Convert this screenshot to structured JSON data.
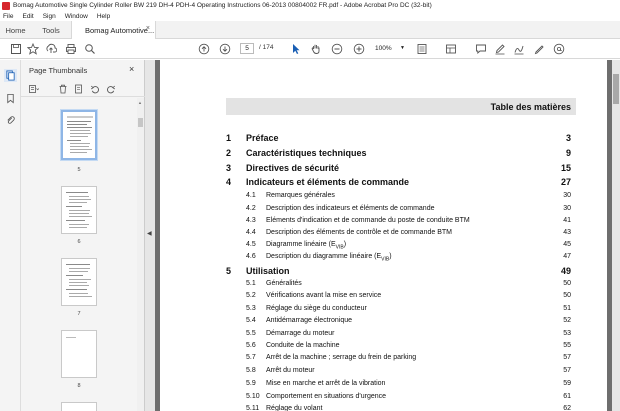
{
  "window": {
    "title": "Bomag Automotive Single Cylinder Roller BW 219 DH-4 PDH-4 Operating Instructions 06-2013 00804002 FR.pdf - Adobe Acrobat Pro DC (32-bit)"
  },
  "menu": [
    "File",
    "Edit",
    "Sign",
    "Window",
    "Help"
  ],
  "tabs": {
    "home": "Home",
    "tools": "Tools",
    "doc": "Bomag Automotive...",
    "close": "×"
  },
  "toolbar": {
    "current_page": "5",
    "page_count": "/ 174",
    "zoom": "100%"
  },
  "thumbnails": {
    "title": "Page Thumbnails",
    "close": "×",
    "pages": [
      "5",
      "6",
      "7",
      "8"
    ]
  },
  "document": {
    "header": "Table des matières",
    "toc": [
      {
        "level": 1,
        "num": "1",
        "text": "Préface",
        "page": "3"
      },
      {
        "level": 1,
        "num": "2",
        "text": "Caractéristiques techniques",
        "page": "9"
      },
      {
        "level": 1,
        "num": "3",
        "text": "Directives de sécurité",
        "page": "15"
      },
      {
        "level": 1,
        "num": "4",
        "text": "Indicateurs et éléments de commande",
        "page": "27"
      },
      {
        "level": 2,
        "num": "4.1",
        "text": "Remarques générales",
        "page": "30"
      },
      {
        "level": 2,
        "num": "4.2",
        "text": "Description des indicateurs et éléments de commande",
        "page": "30"
      },
      {
        "level": 2,
        "num": "4.3",
        "text": "Eléments d'indication et de commande du poste de conduite BTM",
        "page": "41"
      },
      {
        "level": 2,
        "num": "4.4",
        "text": "Description des éléments de contrôle et de commande BTM",
        "page": "43"
      },
      {
        "level": 2,
        "num": "4.5",
        "text": "Diagramme linéaire  (E",
        "sub": "VIB",
        "tail": ")",
        "page": "45"
      },
      {
        "level": 2,
        "num": "4.6",
        "text": "Description du diagramme linéaire  (E",
        "sub": "VIB",
        "tail": ")",
        "page": "47"
      },
      {
        "level": 1,
        "num": "5",
        "text": "Utilisation",
        "page": "49"
      },
      {
        "level": 2,
        "num": "5.1",
        "text": "Généralités",
        "page": "50"
      },
      {
        "level": 2,
        "num": "5.2",
        "text": "Vérifications avant la mise en service",
        "page": "50"
      },
      {
        "level": 2,
        "num": "5.3",
        "text": "Réglage du siège du conducteur",
        "page": "51"
      },
      {
        "level": 2,
        "num": "5.4",
        "text": "Antidémarrage électronique",
        "page": "52"
      },
      {
        "level": 2,
        "num": "5.5",
        "text": "Démarrage du moteur",
        "page": "53"
      },
      {
        "level": 2,
        "num": "5.6",
        "text": "Conduite de la machine",
        "page": "55"
      },
      {
        "level": 2,
        "num": "5.7",
        "text": "Arrêt de la machine ; serrage du frein de parking",
        "page": "57"
      },
      {
        "level": 2,
        "num": "5.8",
        "text": "Arrêt du moteur",
        "page": "57"
      },
      {
        "level": 2,
        "num": "5.9",
        "text": "Mise en marche et arrêt de la vibration",
        "page": "59"
      },
      {
        "level": 2,
        "num": "5.10",
        "text": "Comportement en situations d'urgence",
        "page": "61"
      },
      {
        "level": 2,
        "num": "5.11",
        "text": "Réglage du volant",
        "page": "62"
      }
    ]
  }
}
